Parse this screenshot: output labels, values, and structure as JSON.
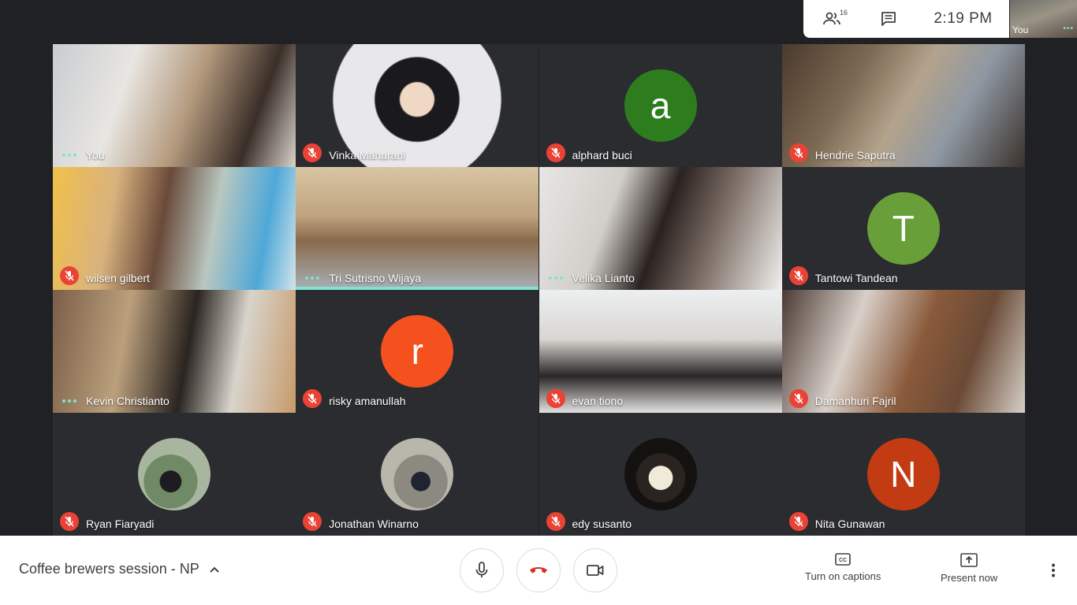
{
  "top_panel": {
    "participants_count": "16",
    "time": "2:19  PM",
    "self_label": "You"
  },
  "tiles": [
    {
      "name": "You",
      "state": "speaking"
    },
    {
      "name": "Vinka Maharani",
      "state": "muted"
    },
    {
      "name": "alphard buci",
      "state": "muted",
      "initial": "a",
      "color": "#2d7d1e"
    },
    {
      "name": "Hendrie Saputra",
      "state": "muted"
    },
    {
      "name": "wilsen gilbert",
      "state": "muted"
    },
    {
      "name": "Tri Sutrisno Wijaya",
      "state": "speaking",
      "active": true
    },
    {
      "name": "Velika Lianto",
      "state": "speaking"
    },
    {
      "name": "Tantowi Tandean",
      "state": "muted",
      "initial": "T",
      "color": "#689f38"
    },
    {
      "name": "Kevin Christianto",
      "state": "speaking"
    },
    {
      "name": "risky amanullah",
      "state": "muted",
      "initial": "r",
      "color": "#f4511e"
    },
    {
      "name": "evan tiono",
      "state": "muted"
    },
    {
      "name": "Damanhuri Fajril",
      "state": "muted"
    },
    {
      "name": "Ryan Fiaryadi",
      "state": "muted"
    },
    {
      "name": "Jonathan Winarno",
      "state": "muted"
    },
    {
      "name": "edy susanto",
      "state": "muted"
    },
    {
      "name": "Nita Gunawan",
      "state": "muted",
      "initial": "N",
      "color": "#c23b13"
    }
  ],
  "bottom_bar": {
    "meeting_title": "Coffee brewers session - NP",
    "captions_label": "Turn on captions",
    "present_label": "Present now"
  },
  "colors": {
    "accent_teal": "#7fe3d1",
    "mute_red": "#ea4335",
    "hangup_red": "#d93025",
    "background": "#202124"
  }
}
